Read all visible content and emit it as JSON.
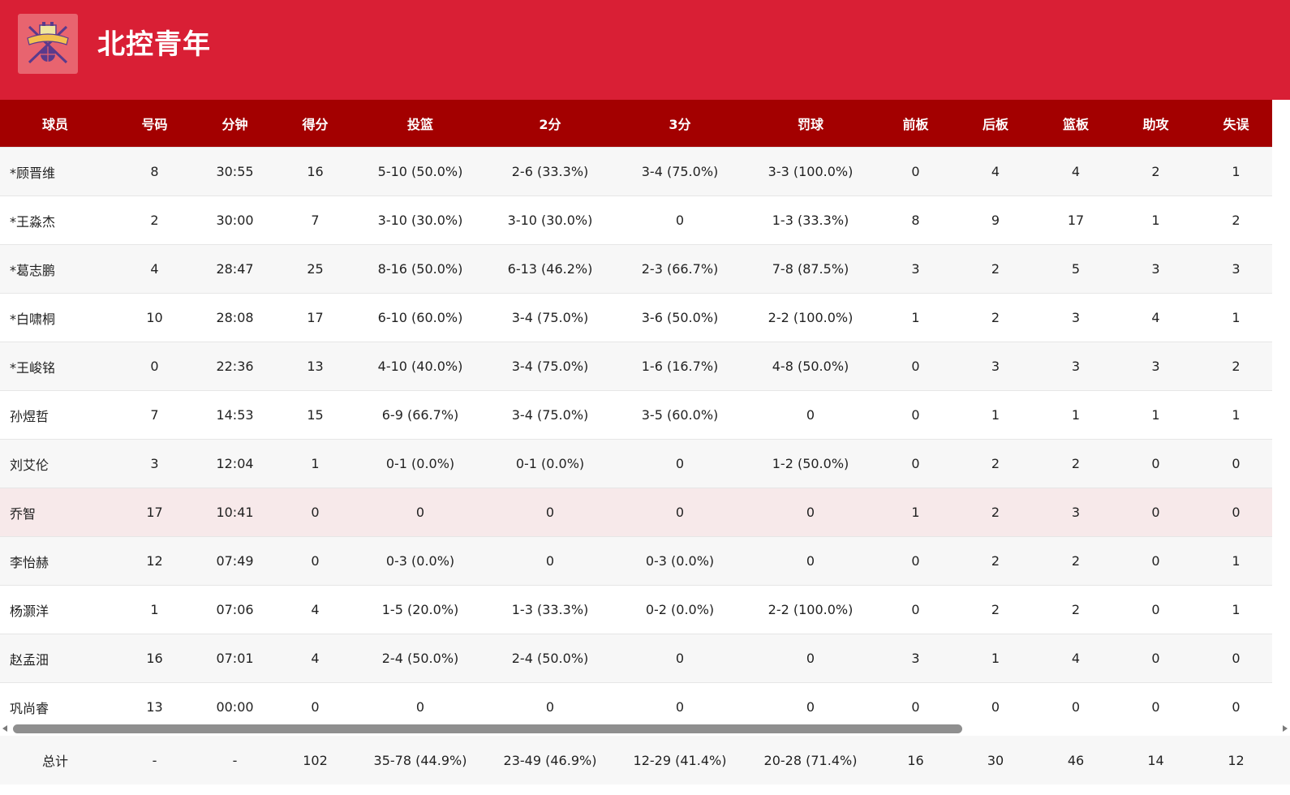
{
  "team": {
    "name": "北控青年",
    "logo": "team-logo-icon"
  },
  "colors": {
    "header_bg": "#d91f35",
    "table_header_bg": "#a30000",
    "highlight_row": "#f7e9ea"
  },
  "columns": [
    "球员",
    "号码",
    "分钟",
    "得分",
    "投篮",
    "2分",
    "3分",
    "罚球",
    "前板",
    "后板",
    "篮板",
    "助攻",
    "失误"
  ],
  "players": [
    [
      "*顾晋维",
      "8",
      "30:55",
      "16",
      "5-10 (50.0%)",
      "2-6 (33.3%)",
      "3-4 (75.0%)",
      "3-3 (100.0%)",
      "0",
      "4",
      "4",
      "2",
      "1"
    ],
    [
      "*王淼杰",
      "2",
      "30:00",
      "7",
      "3-10 (30.0%)",
      "3-10 (30.0%)",
      "0",
      "1-3 (33.3%)",
      "8",
      "9",
      "17",
      "1",
      "2"
    ],
    [
      "*葛志鹏",
      "4",
      "28:47",
      "25",
      "8-16 (50.0%)",
      "6-13 (46.2%)",
      "2-3 (66.7%)",
      "7-8 (87.5%)",
      "3",
      "2",
      "5",
      "3",
      "3"
    ],
    [
      "*白啸桐",
      "10",
      "28:08",
      "17",
      "6-10 (60.0%)",
      "3-4 (75.0%)",
      "3-6 (50.0%)",
      "2-2 (100.0%)",
      "1",
      "2",
      "3",
      "4",
      "1"
    ],
    [
      "*王峻铭",
      "0",
      "22:36",
      "13",
      "4-10 (40.0%)",
      "3-4 (75.0%)",
      "1-6 (16.7%)",
      "4-8 (50.0%)",
      "0",
      "3",
      "3",
      "3",
      "2"
    ],
    [
      "孙煜哲",
      "7",
      "14:53",
      "15",
      "6-9 (66.7%)",
      "3-4 (75.0%)",
      "3-5 (60.0%)",
      "0",
      "0",
      "1",
      "1",
      "1",
      "1"
    ],
    [
      "刘艾伦",
      "3",
      "12:04",
      "1",
      "0-1 (0.0%)",
      "0-1 (0.0%)",
      "0",
      "1-2 (50.0%)",
      "0",
      "2",
      "2",
      "0",
      "0"
    ],
    [
      "乔智",
      "17",
      "10:41",
      "0",
      "0",
      "0",
      "0",
      "0",
      "1",
      "2",
      "3",
      "0",
      "0"
    ],
    [
      "李怡赫",
      "12",
      "07:49",
      "0",
      "0-3 (0.0%)",
      "0",
      "0-3 (0.0%)",
      "0",
      "0",
      "2",
      "2",
      "0",
      "1"
    ],
    [
      "杨灏洋",
      "1",
      "07:06",
      "4",
      "1-5 (20.0%)",
      "1-3 (33.3%)",
      "0-2 (0.0%)",
      "2-2 (100.0%)",
      "0",
      "2",
      "2",
      "0",
      "1"
    ],
    [
      "赵孟沺",
      "16",
      "07:01",
      "4",
      "2-4 (50.0%)",
      "2-4 (50.0%)",
      "0",
      "0",
      "3",
      "1",
      "4",
      "0",
      "0"
    ],
    [
      "巩尚睿",
      "13",
      "00:00",
      "0",
      "0",
      "0",
      "0",
      "0",
      "0",
      "0",
      "0",
      "0",
      "0"
    ]
  ],
  "totals": [
    "总计",
    "-",
    "-",
    "102",
    "35-78 (44.9%)",
    "23-49 (46.9%)",
    "12-29 (41.4%)",
    "20-28 (71.4%)",
    "16",
    "30",
    "46",
    "14",
    "12"
  ]
}
